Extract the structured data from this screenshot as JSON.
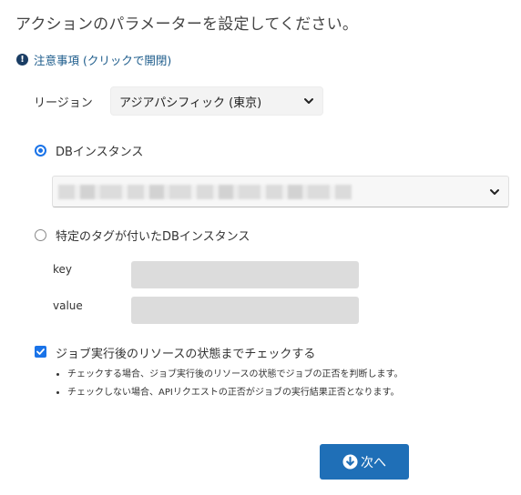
{
  "header": {
    "title": "アクションのパラメーターを設定してください。"
  },
  "notice": {
    "label": "注意事項 (クリックで開閉)",
    "icon": "exclamation-circle-icon"
  },
  "region": {
    "label": "リージョン",
    "selected": "アジアパシフィック (東京)"
  },
  "target": {
    "db_instance": {
      "label": "DBインスタンス",
      "checked": true
    },
    "tagged_instance": {
      "label": "特定のタグが付いたDBインスタンス",
      "checked": false
    }
  },
  "tag": {
    "key_label": "key",
    "key_value": "",
    "value_label": "value",
    "value_value": ""
  },
  "check_status": {
    "label": "ジョブ実行後のリソースの状態までチェックする",
    "checked": true,
    "notes": [
      "チェックする場合、ジョブ実行後のリソースの状態でジョブの正否を判断します。",
      "チェックしない場合、APIリクエストの正否がジョブの実行結果正否となります。"
    ]
  },
  "next_button": {
    "label": "次へ",
    "icon": "arrow-down-circle-icon"
  },
  "colors": {
    "accent": "#1a73e8",
    "button": "#1f6fb7",
    "link": "#1a5a8a"
  }
}
